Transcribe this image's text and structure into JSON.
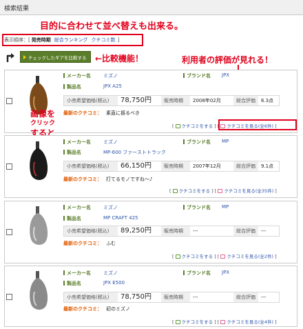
{
  "header": {
    "title": "検索結果"
  },
  "annotations": {
    "sort": "目的に合わせて並べ替えも出来る。",
    "compare": "←比較機能！",
    "review": "利用者の評価が見れる！",
    "image_line1": "画像を",
    "image_line2": "クリック",
    "image_line3": "すると"
  },
  "sort": {
    "label": "表示順序：[",
    "current": "発売時期",
    "options": [
      "総合ランキング",
      "クチコミ数"
    ],
    "close": "]"
  },
  "compare_button": {
    "label": "チェックしたギアを比較する"
  },
  "labels": {
    "maker": "メーカー名",
    "brand": "ブランド名",
    "product": "製品名",
    "price": "小売希望価格(税込)",
    "release": "販売時期",
    "rating": "総合評価",
    "review": "最新のクチコミ：",
    "write": "クチコミをする"
  },
  "products": [
    {
      "maker": "ミズノ",
      "brand": "JPX",
      "name": "JPX A25",
      "price": "78,750円",
      "release": "2008年02月",
      "rating": "6.3点",
      "review": "素直に振るべき",
      "view": "クチコミを見る(全6件)"
    },
    {
      "maker": "ミズノ",
      "brand": "MP",
      "name": "MP-600 ファーストトラック",
      "price": "66,150円",
      "release": "2007年12月",
      "rating": "9.1点",
      "review": "打てるモノですね～♪",
      "view": "クチコミを見る(全35件)"
    },
    {
      "maker": "ミズノ",
      "brand": "MP",
      "name": "MP CRAFT 425",
      "price": "89,250円",
      "release": "---",
      "rating": "---",
      "review": "ふむ",
      "view": "クチコミを見る(全2件)"
    },
    {
      "maker": "ミズノ",
      "brand": "JPX",
      "name": "JPX E500",
      "price": "78,750円",
      "release": "---",
      "rating": "---",
      "review": "初のミズノ",
      "view": "クチコミを見る(全4件)"
    }
  ],
  "colors": {
    "accent_red": "#e0001b",
    "label_green": "#5a7d2a",
    "link_blue": "#2b52a8",
    "review_orange": "#e05a00"
  },
  "icons": [
    "arrow-return-icon",
    "compare-triangle-icon",
    "write-review-icon",
    "view-review-icon",
    "golf-driver-image"
  ]
}
